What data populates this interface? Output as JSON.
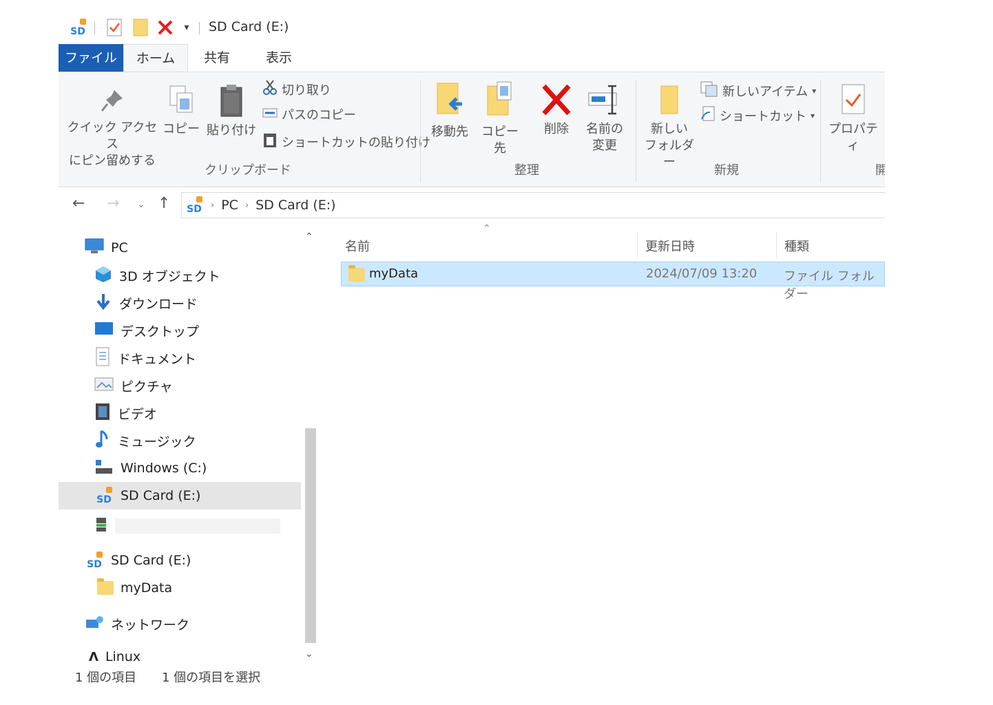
{
  "window": {
    "title": "SD Card (E:)"
  },
  "quick_access": {
    "icons": [
      "sd-drive-icon",
      "properties-check-icon",
      "new-folder-icon",
      "delete-icon",
      "customize-arrow-icon"
    ]
  },
  "tabs": [
    {
      "label": "ファイル"
    },
    {
      "label": "ホーム"
    },
    {
      "label": "共有"
    },
    {
      "label": "表示"
    }
  ],
  "ribbon": {
    "clipboard": {
      "pin_label_1": "クイック アクセス",
      "pin_label_2": "にピン留めする",
      "copy_label": "コピー",
      "paste_label": "貼り付け",
      "cut_label": "切り取り",
      "copy_path_label": "パスのコピー",
      "paste_shortcut_label": "ショートカットの貼り付け",
      "group_label": "クリップボード"
    },
    "organize": {
      "move_to_label": "移動先",
      "copy_to_label": "コピー先",
      "delete_label": "削除",
      "rename_label_1": "名前の",
      "rename_label_2": "変更",
      "group_label": "整理"
    },
    "new": {
      "new_folder_label_1": "新しい",
      "new_folder_label_2": "フォルダー",
      "new_item_label": "新しいアイテム",
      "shortcut_label": "ショートカット",
      "group_label": "新規"
    },
    "open": {
      "properties_label": "プロパティ",
      "group_label": "開"
    }
  },
  "address": {
    "crumbs": [
      "PC",
      "SD Card (E:)"
    ]
  },
  "tree": {
    "pc": "PC",
    "objects3d": "3D オブジェクト",
    "downloads": "ダウンロード",
    "desktop": "デスクトップ",
    "documents": "ドキュメント",
    "pictures": "ピクチャ",
    "videos": "ビデオ",
    "music": "ミュージック",
    "windows_c": "Windows (C:)",
    "sdcard_e": "SD Card (E:)",
    "sdcard_root": "SD Card (E:)",
    "mydata": "myData",
    "network": "ネットワーク",
    "linux": "Linux"
  },
  "list": {
    "columns": {
      "name": "名前",
      "date": "更新日時",
      "type": "種類"
    },
    "rows": [
      {
        "name": "myData",
        "date": "2024/07/09 13:20",
        "type": "ファイル フォルダー"
      }
    ]
  },
  "status": {
    "count": "1 個の項目",
    "selected": "1 個の項目を選択"
  }
}
